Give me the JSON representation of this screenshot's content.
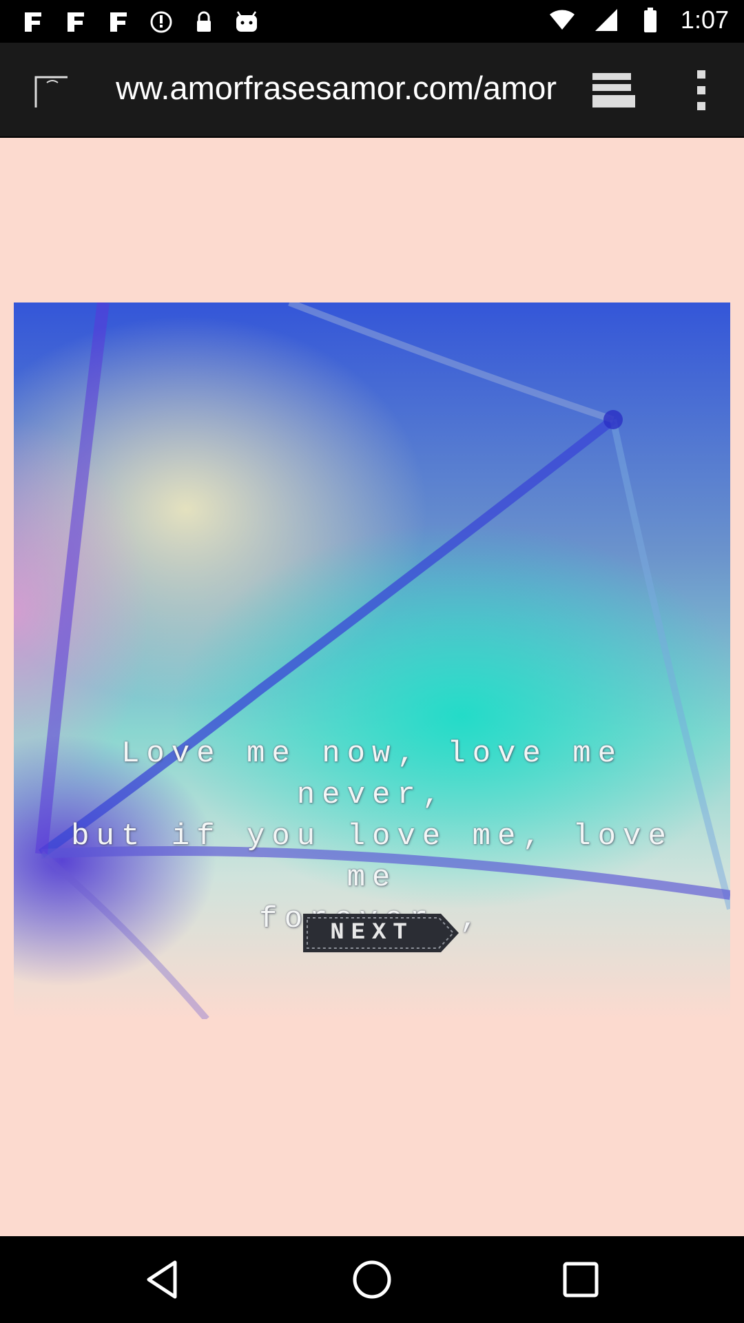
{
  "status_bar": {
    "time": "1:07",
    "left_icons": [
      "app-notification-icon",
      "app-notification-icon",
      "app-notification-icon",
      "sync-icon",
      "lock-icon",
      "android-icon"
    ]
  },
  "browser": {
    "url": "www.amorfrasesamor.com/amor",
    "load_progress": 0.92,
    "accent_color": "#3db3e8"
  },
  "content": {
    "background_color": "#fcdacf",
    "quote": "Love me now, love me never,\nbut if you love me, love me\nforever.,",
    "next_label": "NEXT"
  },
  "nav_bar": {
    "buttons": [
      "back-icon",
      "home-icon",
      "recents-icon"
    ]
  }
}
